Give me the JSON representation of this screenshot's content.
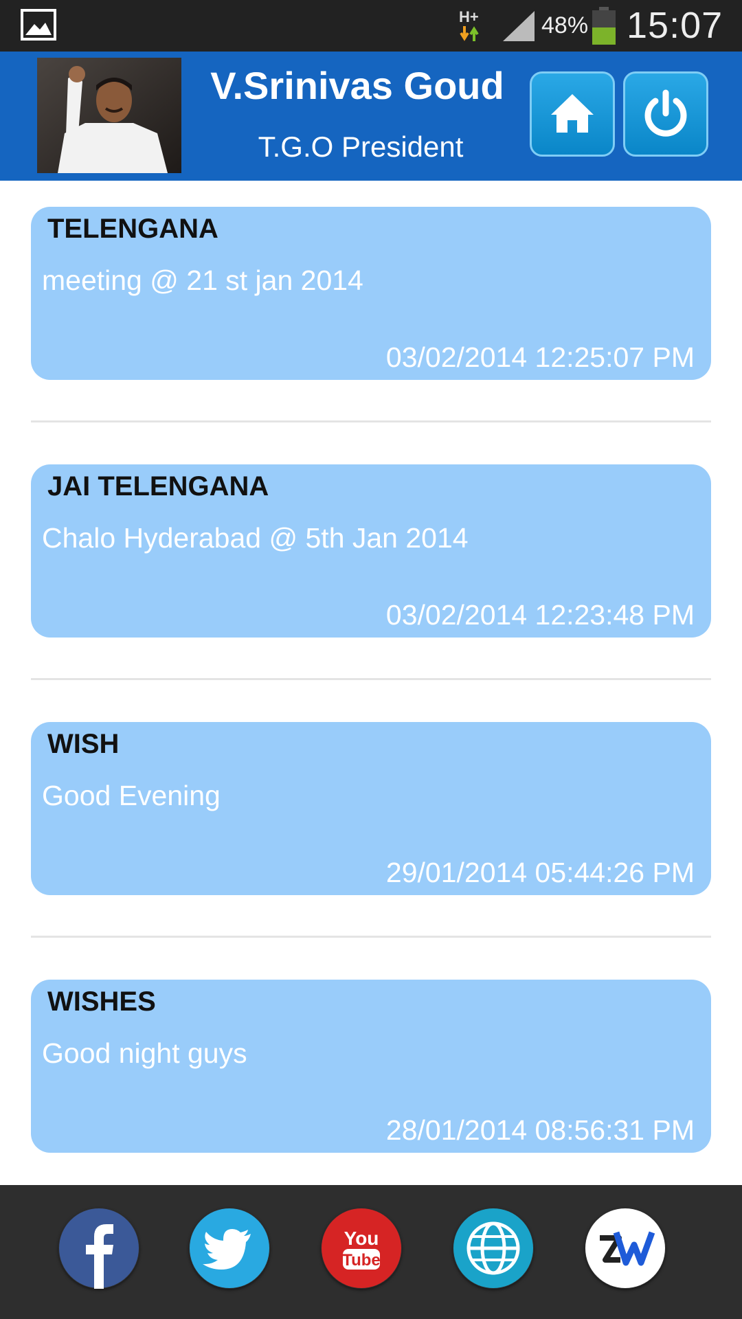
{
  "status_bar": {
    "network": "H+",
    "battery_percent": "48%",
    "time": "15:07",
    "icons": [
      "gallery-icon",
      "network-activity-icon",
      "signal-icon",
      "battery-icon"
    ]
  },
  "header": {
    "name": "V.Srinivas Goud",
    "designation": "T.G.O President",
    "buttons": [
      "home-icon",
      "power-icon"
    ],
    "color": "#1565c0"
  },
  "messages": [
    {
      "title": "TELENGANA",
      "body": "meeting @ 21 st jan 2014",
      "timestamp": "03/02/2014 12:25:07 PM"
    },
    {
      "title": "JAI TELENGANA",
      "body": "Chalo Hyderabad @ 5th Jan 2014",
      "timestamp": "03/02/2014 12:23:48 PM"
    },
    {
      "title": "WISH",
      "body": "Good Evening",
      "timestamp": "29/01/2014 05:44:26 PM"
    },
    {
      "title": "WISHES",
      "body": "Good night guys",
      "timestamp": "28/01/2014 08:56:31 PM"
    }
  ],
  "social_links": [
    {
      "name": "facebook-icon",
      "color": "#3b5998"
    },
    {
      "name": "twitter-icon",
      "color": "#29a9e1"
    },
    {
      "name": "youtube-icon",
      "color": "#d62424"
    },
    {
      "name": "website-globe-icon",
      "color": "#1aa3c9"
    },
    {
      "name": "zw-logo-icon",
      "color": "#ffffff"
    }
  ],
  "colors": {
    "card_background": "#99ccfa",
    "bottom_bar": "#2e2e2e"
  }
}
